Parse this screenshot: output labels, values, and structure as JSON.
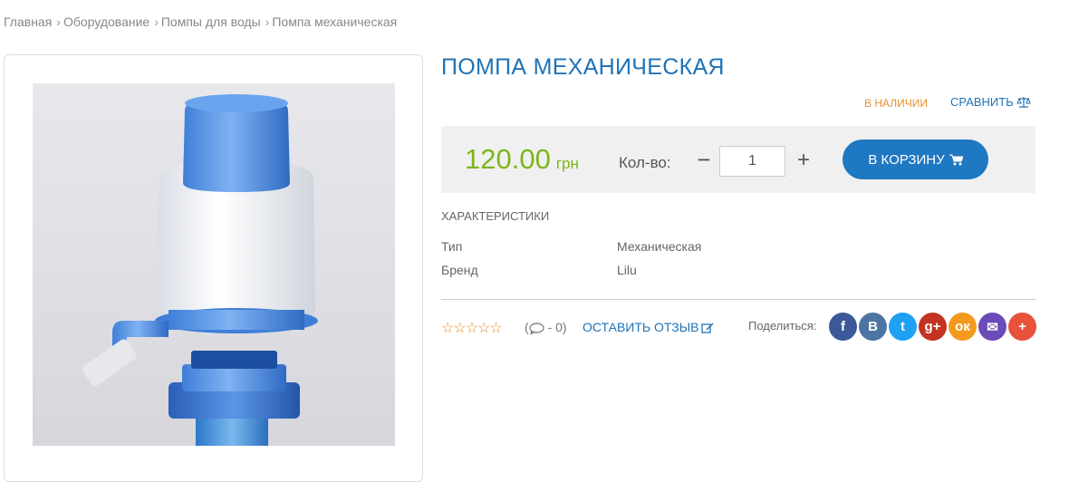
{
  "breadcrumb": [
    "Главная",
    "Оборудование",
    "Помпы для воды",
    "Помпа механическая"
  ],
  "product": {
    "title": "ПОМПА МЕХАНИЧЕСКАЯ",
    "availability": "В НАЛИЧИИ",
    "compare_label": "СРАВНИТЬ",
    "price": "120.00",
    "currency": "грн",
    "quantity_label": "Кол-во:",
    "quantity_value": "1",
    "minus_label": "−",
    "plus_label": "+",
    "cart_button": "В КОРЗИНУ"
  },
  "specs": {
    "title": "ХАРАКТЕРИСТИКИ",
    "rows": [
      {
        "key": "Тип",
        "value": "Механическая"
      },
      {
        "key": "Бренд",
        "value": "Lilu"
      }
    ]
  },
  "reviews": {
    "stars": "☆☆☆☆☆",
    "comments_count": "- 0",
    "leave_review": "ОСТАВИТЬ ОТЗЫВ"
  },
  "share": {
    "label": "Поделиться:",
    "buttons": [
      {
        "icon": "facebook-icon",
        "glyph": "f",
        "color": "#3b5998"
      },
      {
        "icon": "vk-icon",
        "glyph": "B",
        "color": "#4c75a3"
      },
      {
        "icon": "twitter-icon",
        "glyph": "t",
        "color": "#1da1f2"
      },
      {
        "icon": "google-plus-icon",
        "glyph": "g+",
        "color": "#c23321"
      },
      {
        "icon": "odnoklassniki-icon",
        "glyph": "ок",
        "color": "#f39a1e"
      },
      {
        "icon": "email-icon",
        "glyph": "✉",
        "color": "#6b4bb8"
      },
      {
        "icon": "more-share-icon",
        "glyph": "+",
        "color": "#e8513a"
      }
    ]
  },
  "colors": {
    "accent": "#1f73b7",
    "price": "#7cb518",
    "availability": "#e8912b"
  }
}
